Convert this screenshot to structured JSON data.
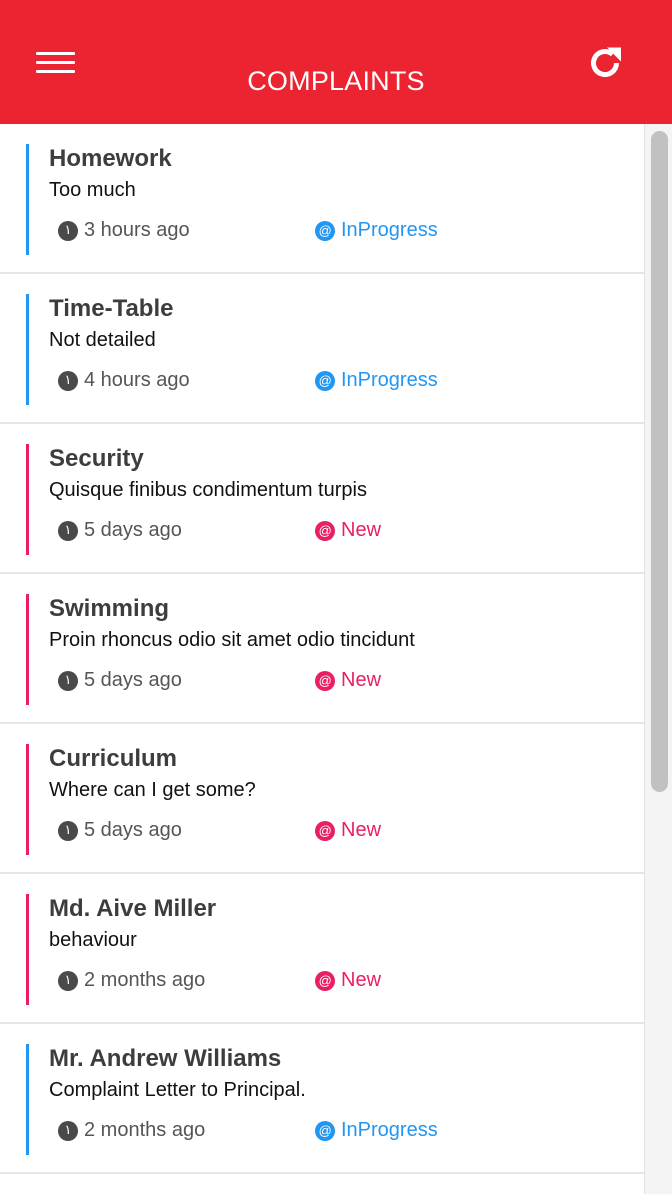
{
  "header": {
    "title": "COMPLAINTS",
    "background_color": "#ec2330",
    "menu_icon": "hamburger-menu-icon",
    "refresh_icon": "refresh-icon"
  },
  "colors": {
    "inprogress": "#2196f3",
    "new": "#e91e63"
  },
  "complaints": [
    {
      "subject": "Homework",
      "description": "Too much",
      "time": "3 hours ago",
      "status": "InProgress"
    },
    {
      "subject": "Time-Table",
      "description": "Not detailed",
      "time": "4 hours ago",
      "status": "InProgress"
    },
    {
      "subject": "Security",
      "description": "Quisque finibus condimentum turpis",
      "time": "5 days ago",
      "status": "New"
    },
    {
      "subject": "Swimming",
      "description": "Proin rhoncus odio sit amet odio tincidunt",
      "time": "5 days ago",
      "status": "New"
    },
    {
      "subject": "Curriculum",
      "description": "Where can I get some?",
      "time": "5 days ago",
      "status": "New"
    },
    {
      "subject": "Md. Aive Miller",
      "description": "behaviour",
      "time": "2 months ago",
      "status": "New"
    },
    {
      "subject": "Mr. Andrew Williams",
      "description": "Complaint Letter to Principal.",
      "time": "2 months ago",
      "status": "InProgress"
    }
  ]
}
